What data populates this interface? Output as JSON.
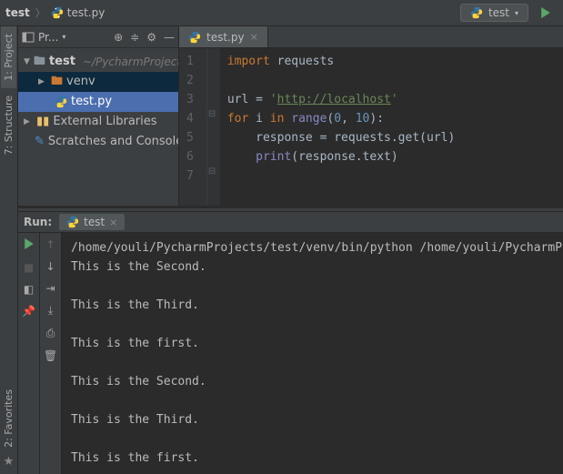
{
  "breadcrumbs": {
    "project": "test",
    "file": "test.py"
  },
  "runConfig": {
    "name": "test"
  },
  "leftTabs": {
    "project": "1: Project",
    "structure": "7: Structure",
    "favorites": "2: Favorites"
  },
  "projectPanel": {
    "title": "Pr...",
    "root": {
      "name": "test",
      "path": "~/PycharmProjects/test"
    },
    "venv": "venv",
    "file": "test.py",
    "extLib": "External Libraries",
    "scratches": "Scratches and Consoles"
  },
  "editor": {
    "tab": "test.py",
    "lines": [
      "1",
      "2",
      "3",
      "4",
      "5",
      "6",
      "7"
    ],
    "code": {
      "l1": {
        "kw1": "import",
        "id": " requests"
      },
      "l3": {
        "id": "url ",
        "eq": "= ",
        "q1": "'",
        "url": "http://localhost",
        "q2": "'"
      },
      "l4": {
        "kw1": "for ",
        "id1": "i ",
        "kw2": "in ",
        "fn": "range",
        "p1": "(",
        "n1": "0",
        "c": ", ",
        "n2": "10",
        "p2": "):"
      },
      "l5": {
        "pad": "    ",
        "id": "response = requests.get(url)"
      },
      "l6": {
        "pad": "    ",
        "fn": "print",
        "rest": "(response.text)"
      }
    }
  },
  "runPanel": {
    "label": "Run:",
    "tab": "test",
    "output": [
      "/home/youli/PycharmProjects/test/venv/bin/python /home/youli/PycharmProjects/test/test.py",
      "This is the Second.",
      "",
      "This is the Third.",
      "",
      "This is the first.",
      "",
      "This is the Second.",
      "",
      "This is the Third.",
      "",
      "This is the first."
    ]
  }
}
